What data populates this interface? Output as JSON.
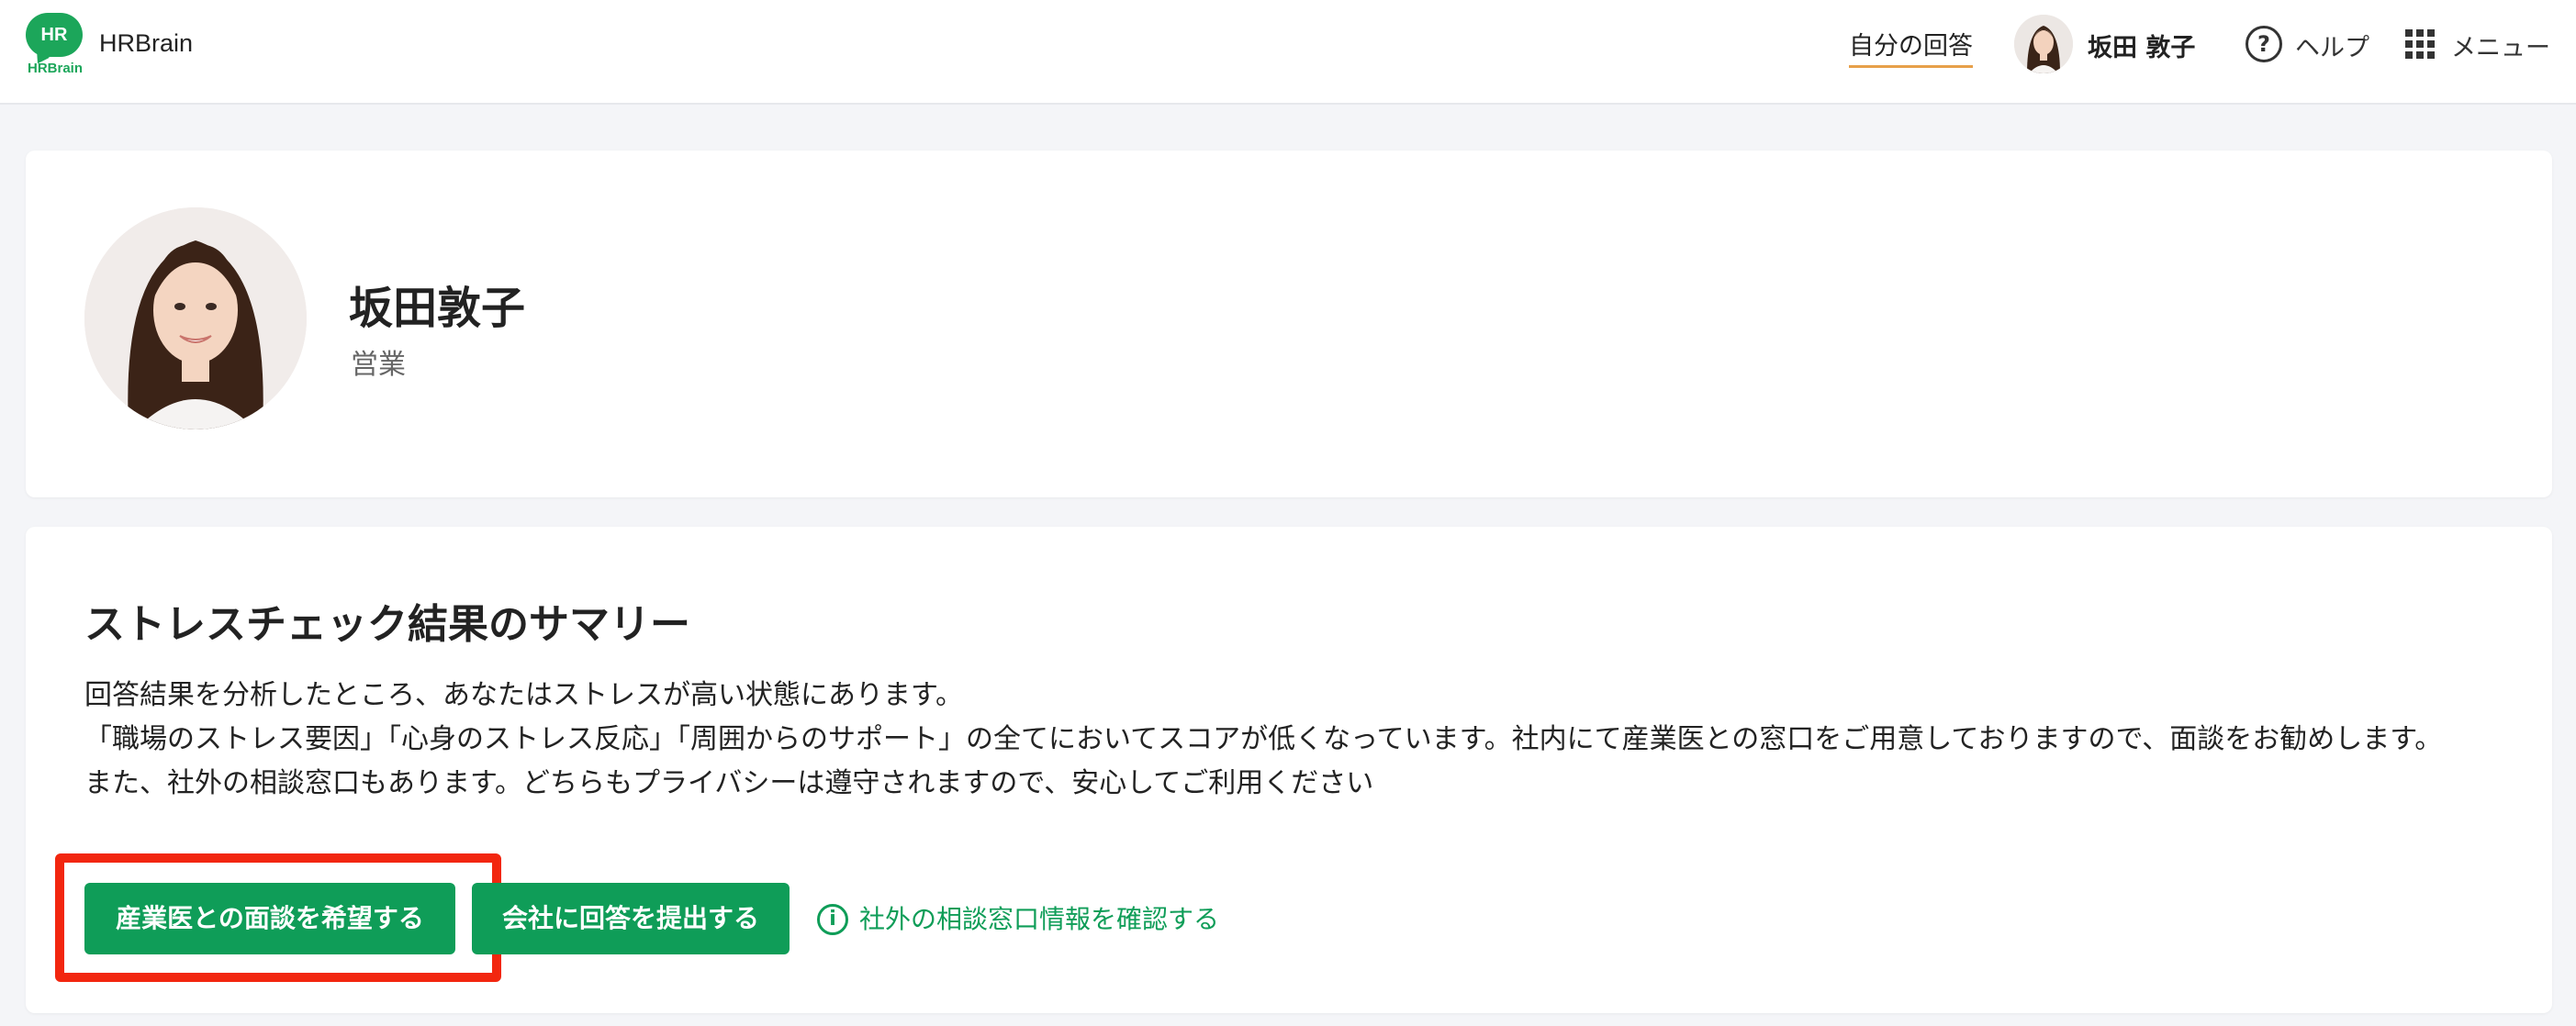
{
  "header": {
    "logo_text": "HR",
    "logo_sub": "HRBrain",
    "brand": "HRBrain",
    "nav_answer": "自分の回答",
    "user_name": "坂田 敦子",
    "help": "ヘルプ",
    "menu": "メニュー"
  },
  "profile": {
    "name": "坂田敦子",
    "department": "営業"
  },
  "summary": {
    "title": "ストレスチェック結果のサマリー",
    "line1": "回答結果を分析したところ、あなたはストレスが高い状態にあります。",
    "line2": "「職場のストレス要因」「心身のストレス反応」「周囲からのサポート」の全てにおいてスコアが低くなっています。社内にて産業医との窓口をご用意しておりますので、面談をお勧めします。",
    "line3": "また、社外の相談窓口もあります。どちらもプライバシーは遵守されますので、安心してご利用ください",
    "btn_interview": "産業医との面談を希望する",
    "btn_submit": "会社に回答を提出する",
    "info_link": "社外の相談窓口情報を確認する"
  },
  "colors": {
    "brand_green": "#0f9d58",
    "highlight_red": "#f2260f",
    "underline_orange": "#e7a04a"
  }
}
